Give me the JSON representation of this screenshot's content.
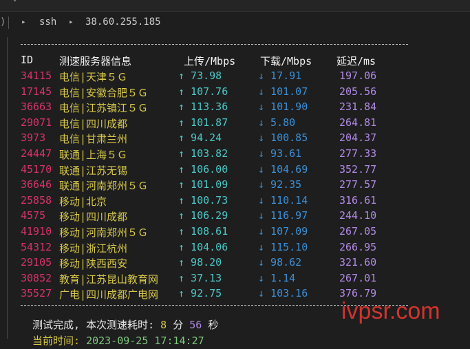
{
  "terminal": {
    "command": "ssh",
    "host": "38.60.255.185"
  },
  "header": {
    "id": "ID",
    "name": "测速服务器信息",
    "up": "上传/Mbps",
    "down": "下载/Mbps",
    "latency": "延迟/ms"
  },
  "rows": [
    {
      "id": "34115",
      "name": "电信|天津５Ｇ",
      "up": "↑ 73.98",
      "down": "↓ 17.91",
      "latency": "197.06"
    },
    {
      "id": "17145",
      "name": "电信|安徽合肥５Ｇ",
      "up": "↑ 107.76",
      "down": "↓ 101.07",
      "latency": "205.56"
    },
    {
      "id": "36663",
      "name": "电信|江苏镇江５Ｇ",
      "up": "↑ 113.36",
      "down": "↓ 101.90",
      "latency": "231.84"
    },
    {
      "id": "29071",
      "name": "电信|四川成都",
      "up": "↑ 101.87",
      "down": "↓ 5.80",
      "latency": "264.81"
    },
    {
      "id": "3973",
      "name": "电信|甘肃兰州",
      "up": "↑ 94.24",
      "down": "↓ 100.85",
      "latency": "204.37"
    },
    {
      "id": "24447",
      "name": "联通|上海５Ｇ",
      "up": "↑ 103.82",
      "down": "↓ 93.61",
      "latency": "277.33"
    },
    {
      "id": "45170",
      "name": "联通|江苏无锡",
      "up": "↑ 106.00",
      "down": "↓ 104.69",
      "latency": "352.77"
    },
    {
      "id": "36646",
      "name": "联通|河南郑州５Ｇ",
      "up": "↑ 101.09",
      "down": "↓ 92.35",
      "latency": "277.57"
    },
    {
      "id": "25858",
      "name": "移动|北京",
      "up": "↑ 100.73",
      "down": "↓ 110.14",
      "latency": "316.61"
    },
    {
      "id": "4575",
      "name": "移动|四川成都",
      "up": "↑ 106.29",
      "down": "↓ 116.97",
      "latency": "244.10"
    },
    {
      "id": "41910",
      "name": "移动|河南郑州５Ｇ",
      "up": "↑ 108.61",
      "down": "↓ 107.09",
      "latency": "267.05"
    },
    {
      "id": "54312",
      "name": "移动|浙江杭州",
      "up": "↑ 104.06",
      "down": "↓ 115.10",
      "latency": "266.95"
    },
    {
      "id": "29105",
      "name": "移动|陕西西安",
      "up": "↑ 98.20",
      "down": "↓ 98.62",
      "latency": "321.60"
    },
    {
      "id": "30852",
      "name": "教育|江苏昆山教育网",
      "up": "↑ 37.13",
      "down": "↓ 1.14",
      "latency": "267.01"
    },
    {
      "id": "35527",
      "name": "广电|四川成都广电网",
      "up": "↑ 92.75",
      "down": "↓ 103.16",
      "latency": "376.79"
    }
  ],
  "footer": {
    "done_label": "测试完成, 本次测速耗时:",
    "minutes": "8",
    "min_unit": "分",
    "seconds": "56",
    "sec_unit": "秒",
    "time_label": "当前时间:",
    "time_value": "2023-09-25 17:14:27"
  },
  "watermark": "ivpsr.com"
}
